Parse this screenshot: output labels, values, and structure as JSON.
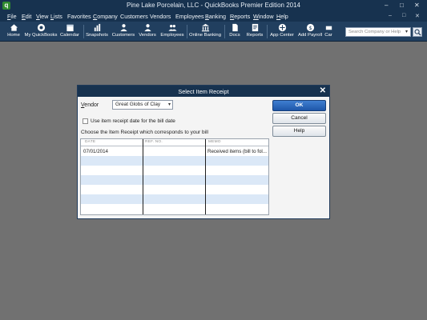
{
  "window": {
    "title": "Pine Lake Porcelain, LLC  -  QuickBooks Premier Edition 2014",
    "controls": [
      "–",
      "□",
      "✕"
    ]
  },
  "menubar": {
    "items": [
      {
        "first": "F",
        "rest": "ile"
      },
      {
        "first": "E",
        "rest": "dit"
      },
      {
        "first": "V",
        "rest": "iew"
      },
      {
        "first": "L",
        "rest": "ists"
      },
      {
        "first": "",
        "rest": "Favorites"
      },
      {
        "first": "C",
        "rest": "ompany"
      },
      {
        "first": "",
        "rest": "Customers"
      },
      {
        "first": "",
        "rest": "Vendors"
      },
      {
        "first": "",
        "rest": "Employees"
      },
      {
        "first": "B",
        "rest": "anking"
      },
      {
        "first": "R",
        "rest": "eports"
      },
      {
        "first": "W",
        "rest": "indow"
      },
      {
        "first": "H",
        "rest": "elp"
      }
    ],
    "right_controls": [
      "–",
      "□",
      "✕"
    ]
  },
  "toolbar": {
    "buttons": [
      {
        "label": "Home",
        "icon": "home-icon"
      },
      {
        "label": "My QuickBooks",
        "icon": "quickbooks-icon"
      },
      {
        "label": "Calendar",
        "icon": "calendar-icon"
      },
      {
        "label": "Snapshots",
        "icon": "snapshots-icon"
      },
      {
        "label": "Customers",
        "icon": "customers-icon"
      },
      {
        "label": "Vendors",
        "icon": "vendors-icon"
      },
      {
        "label": "Employees",
        "icon": "employees-icon"
      },
      {
        "label": "Online Banking",
        "icon": "online-banking-icon"
      },
      {
        "label": "Docs",
        "icon": "docs-icon"
      },
      {
        "label": "Reports",
        "icon": "reports-icon"
      },
      {
        "label": "App Center",
        "icon": "app-center-icon"
      },
      {
        "label": "Add Payroll",
        "icon": "add-payroll-icon"
      },
      {
        "label": "Car",
        "icon": "car-icon"
      }
    ],
    "search": {
      "placeholder": "Search Company or Help",
      "arrow": "▾"
    }
  },
  "dialog": {
    "title": "Select Item Receipt",
    "close": "✕",
    "vendor_label_first": "V",
    "vendor_label_rest": "endor",
    "vendor_value": "Great Globs of Clay",
    "vendor_arrow": "▾",
    "checkbox_label": "Use item receipt date for the bill date",
    "checkbox_checked": false,
    "instruction": "Choose the Item Receipt which corresponds to your bill",
    "columns": [
      "DATE",
      "REF. NO.",
      "MEMO"
    ],
    "rows": [
      {
        "date": "07/01/2014",
        "ref": "",
        "memo": "Received items (bill to fol..."
      },
      {
        "date": "",
        "ref": "",
        "memo": ""
      },
      {
        "date": "",
        "ref": "",
        "memo": ""
      },
      {
        "date": "",
        "ref": "",
        "memo": ""
      },
      {
        "date": "",
        "ref": "",
        "memo": ""
      },
      {
        "date": "",
        "ref": "",
        "memo": ""
      },
      {
        "date": "",
        "ref": "",
        "memo": ""
      }
    ],
    "buttons": {
      "ok": "OK",
      "cancel": "Cancel",
      "help": "Help"
    }
  },
  "colors": {
    "title_bar": "#17324f",
    "toolbar": "#213f5f",
    "desktop": "#717171",
    "row_alt": "#dbe8f7",
    "ok_button": "#2a66b8"
  }
}
